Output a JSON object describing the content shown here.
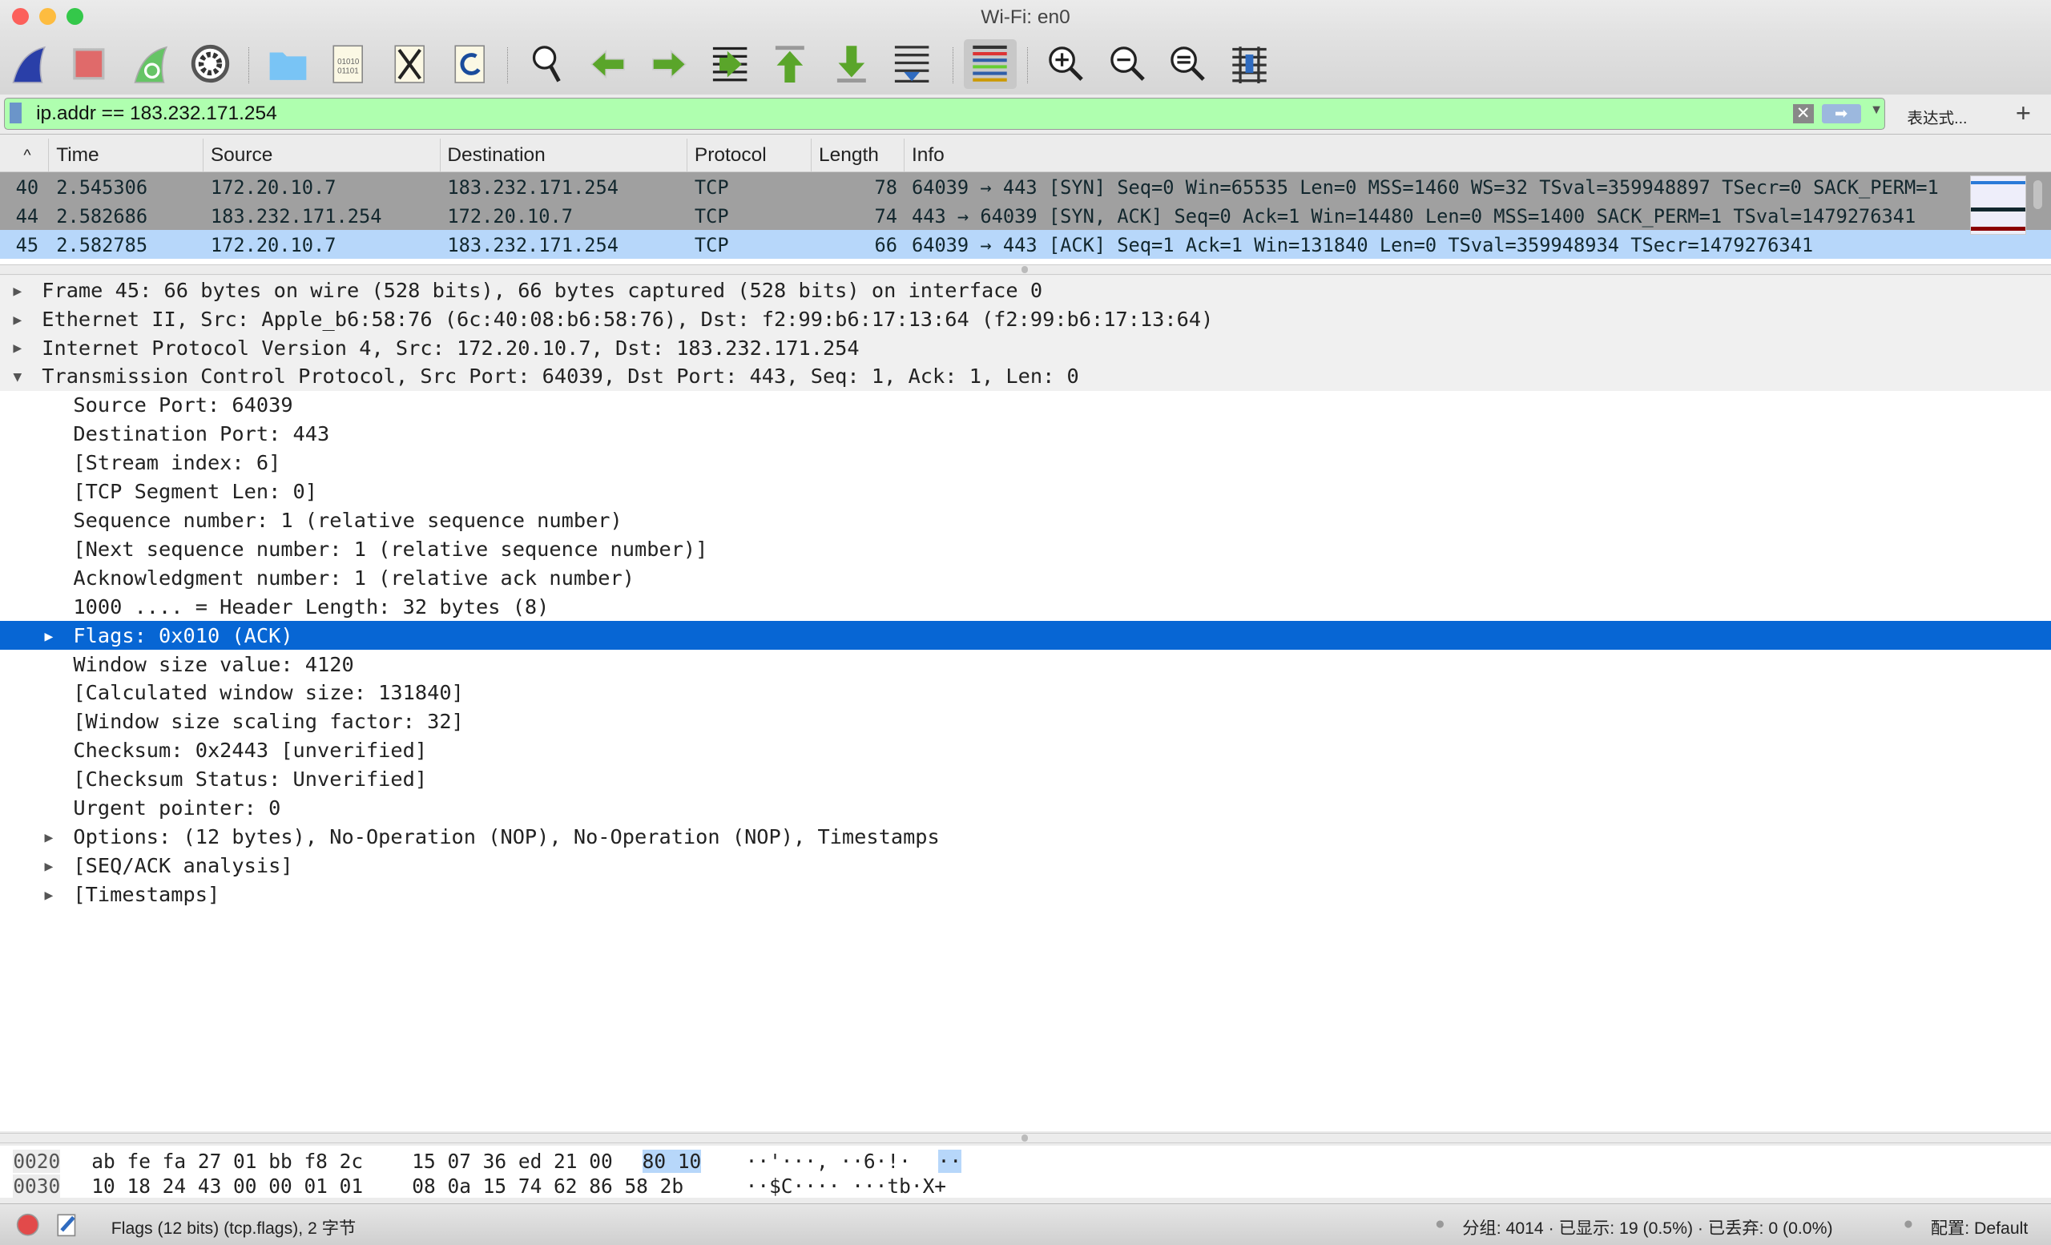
{
  "window": {
    "title": "Wi-Fi: en0",
    "lights": [
      "#fc605b",
      "#fdbc40",
      "#34c84a"
    ]
  },
  "toolbar": {
    "buttons": [
      "start-capture",
      "stop-capture",
      "restart-capture",
      "capture-options",
      "open-file",
      "save-file",
      "close-file",
      "reload-file",
      "find-packet",
      "go-back",
      "go-forward",
      "go-to-packet",
      "first-packet",
      "last-packet",
      "auto-scroll",
      "colorize",
      "zoom-in",
      "zoom-out",
      "normal-size",
      "resize-columns"
    ],
    "active": "colorize"
  },
  "filter": {
    "value": "ip.addr == 183.232.171.254",
    "expression_label": "表达式...",
    "add_label": "+",
    "clear_label": "✕",
    "apply_label": "➡",
    "color": "#afffaf"
  },
  "packet_list": {
    "columns": [
      "Time",
      "Source",
      "Destination",
      "Protocol",
      "Length",
      "Info"
    ],
    "sort_indicator": "^",
    "rows": [
      {
        "no": "40",
        "time": "2.545306",
        "source": "172.20.10.7",
        "destination": "183.232.171.254",
        "protocol": "TCP",
        "length": "78",
        "info": "64039 → 443 [SYN] Seq=0 Win=65535 Len=0 MSS=1460 WS=32 TSval=359948897 TSecr=0 SACK_PERM=1",
        "style": "g"
      },
      {
        "no": "44",
        "time": "2.582686",
        "source": "183.232.171.254",
        "destination": "172.20.10.7",
        "protocol": "TCP",
        "length": "74",
        "info": "443 → 64039 [SYN, ACK] Seq=0 Ack=1 Win=14480 Len=0 MSS=1400 SACK_PERM=1 TSval=1479276341",
        "style": "g"
      },
      {
        "no": "45",
        "time": "2.582785",
        "source": "172.20.10.7",
        "destination": "183.232.171.254",
        "protocol": "TCP",
        "length": "66",
        "info": "64039 → 443 [ACK] Seq=1 Ack=1 Win=131840 Len=0 TSval=359948934 TSecr=1479276341",
        "style": "sel"
      }
    ]
  },
  "details": [
    {
      "text": "Frame 45: 66 bytes on wire (528 bits), 66 bytes captured (528 bits) on interface 0",
      "level": 0,
      "toggle": "collapsed"
    },
    {
      "text": "Ethernet II, Src: Apple_b6:58:76 (6c:40:08:b6:58:76), Dst: f2:99:b6:17:13:64 (f2:99:b6:17:13:64)",
      "level": 0,
      "toggle": "collapsed"
    },
    {
      "text": "Internet Protocol Version 4, Src: 172.20.10.7, Dst: 183.232.171.254",
      "level": 0,
      "toggle": "collapsed"
    },
    {
      "text": "Transmission Control Protocol, Src Port: 64039, Dst Port: 443, Seq: 1, Ack: 1, Len: 0",
      "level": 0,
      "toggle": "expanded"
    },
    {
      "text": "Source Port: 64039",
      "level": 1
    },
    {
      "text": "Destination Port: 443",
      "level": 1
    },
    {
      "text": "[Stream index: 6]",
      "level": 1
    },
    {
      "text": "[TCP Segment Len: 0]",
      "level": 1
    },
    {
      "text": "Sequence number: 1    (relative sequence number)",
      "level": 1
    },
    {
      "text": "[Next sequence number: 1    (relative sequence number)]",
      "level": 1
    },
    {
      "text": "Acknowledgment number: 1    (relative ack number)",
      "level": 1
    },
    {
      "text": "1000 .... = Header Length: 32 bytes (8)",
      "level": 1
    },
    {
      "text": "Flags: 0x010 (ACK)",
      "level": 1,
      "toggle": "collapsed",
      "selected": true
    },
    {
      "text": "Window size value: 4120",
      "level": 1
    },
    {
      "text": "[Calculated window size: 131840]",
      "level": 1
    },
    {
      "text": "[Window size scaling factor: 32]",
      "level": 1
    },
    {
      "text": "Checksum: 0x2443 [unverified]",
      "level": 1
    },
    {
      "text": "[Checksum Status: Unverified]",
      "level": 1
    },
    {
      "text": "Urgent pointer: 0",
      "level": 1
    },
    {
      "text": "Options: (12 bytes), No-Operation (NOP), No-Operation (NOP), Timestamps",
      "level": 1,
      "toggle": "collapsed"
    },
    {
      "text": "[SEQ/ACK analysis]",
      "level": 1,
      "toggle": "collapsed"
    },
    {
      "text": "[Timestamps]",
      "level": 1,
      "toggle": "collapsed"
    }
  ],
  "bytes": [
    {
      "offset": "0020",
      "hex_a": "ab fe fa 27 01 bb f8 2c",
      "hex_b": "15 07 36 ed 21 00",
      "hex_hl": "80 10",
      "ascii": "··'···, ··6·!·",
      "ascii_hl": "··"
    },
    {
      "offset": "0030",
      "hex_a": "10 18 24 43 00 00 01 01",
      "hex_b": "08 0a 15 74 62 86 58 2b",
      "hex_hl": "",
      "ascii": "··$C···· ···tb·X+",
      "ascii_hl": ""
    }
  ],
  "status": {
    "field": "Flags (12 bits) (tcp.flags), 2 字节",
    "packets": "分组: 4014 · 已显示: 19 (0.5%) · 已丢弃: 0 (0.0%)",
    "profile": "配置: Default"
  }
}
